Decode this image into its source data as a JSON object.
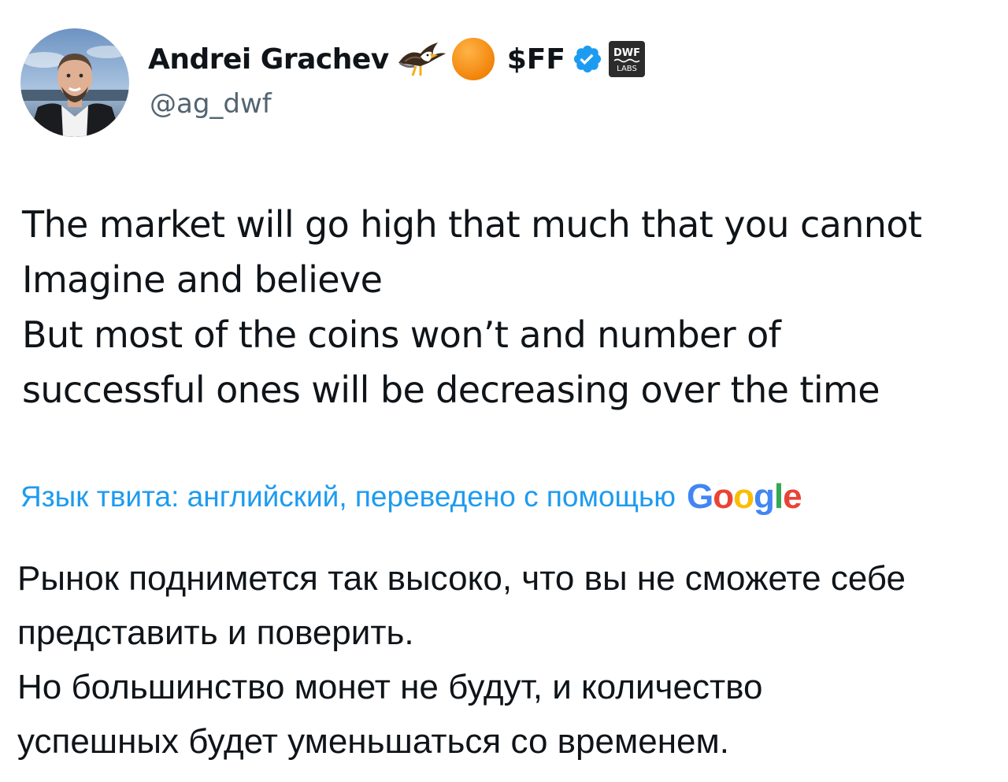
{
  "author": {
    "display_name": "Andrei Grachev",
    "name_emojis": [
      "eagle-icon",
      "orange-circle-icon"
    ],
    "name_ticker": "$FF",
    "verified": true,
    "affiliate_badge_text": "DWF LABS",
    "handle": "@ag_dwf"
  },
  "tweet": {
    "lines": [
      "The market will go high that much that you cannot",
      "Imagine and believe",
      "But most of the coins won’t and number of",
      "successful ones will be decreasing over the time"
    ]
  },
  "translation": {
    "label": "Язык твита: английский, переведено с помощью",
    "provider": "Google",
    "lines": [
      "Рынок поднимется так высоко, что вы не сможете себе",
      "представить и поверить.",
      "Но большинство монет не будут, и количество",
      "успешных будет уменьшаться со временем."
    ]
  },
  "colors": {
    "text": "#0f1419",
    "secondary": "#536471",
    "link": "#1d9bf0",
    "verified": "#1d9bf0",
    "google_blue": "#4285f4",
    "google_red": "#ea4335",
    "google_yellow": "#fbbc05",
    "google_green": "#34a853"
  }
}
